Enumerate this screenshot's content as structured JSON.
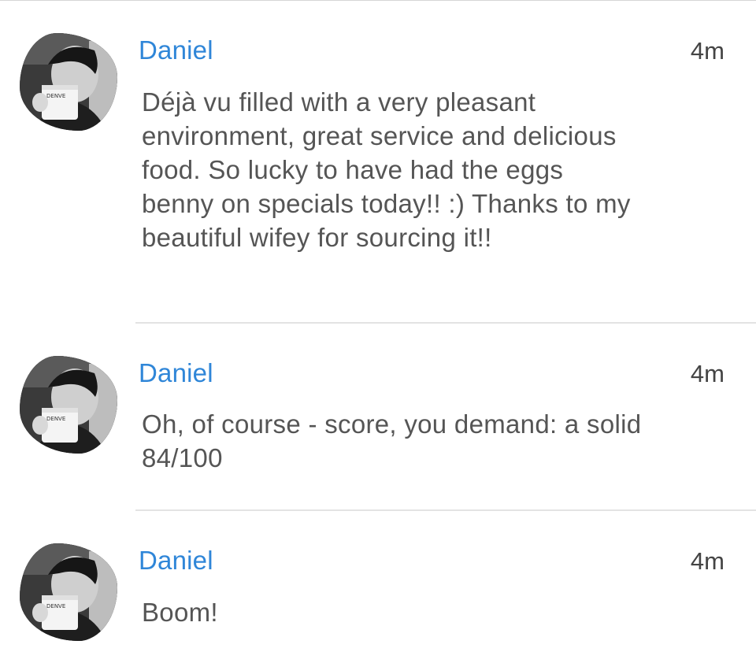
{
  "comments": [
    {
      "author": "Daniel",
      "time": "4m",
      "text": "Déjà vu filled with a very pleasant\nenvironment, great service and delicious\nfood. So lucky to have had the eggs\nbenny on specials today!! :) Thanks to my\nbeautiful wifey for sourcing it!!"
    },
    {
      "author": "Daniel",
      "time": "4m",
      "text": "Oh, of course - score, you demand: a solid\n84/100"
    },
    {
      "author": "Daniel",
      "time": "4m",
      "text": "Boom!"
    }
  ],
  "avatar": {
    "mug_text": "DENVE"
  }
}
